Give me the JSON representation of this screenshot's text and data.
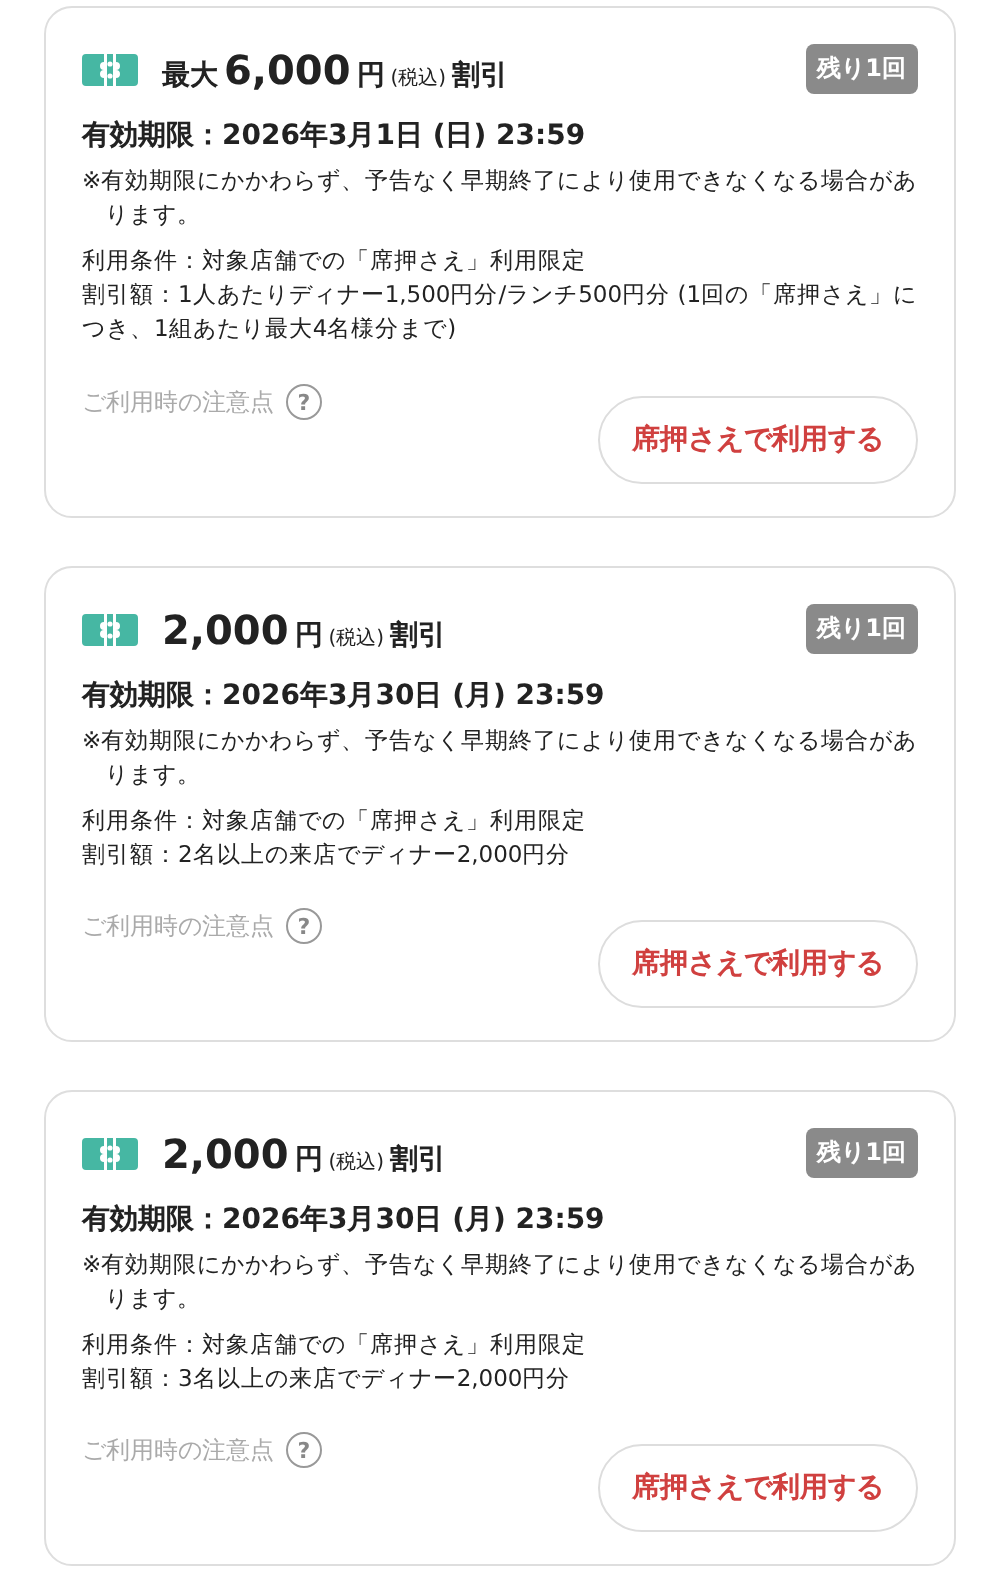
{
  "coupons": [
    {
      "prefix": "最大",
      "amount": "6,000",
      "unit": "円",
      "tax": "(税込)",
      "suffix": "割引",
      "remaining": "残り1回",
      "expiry": "有効期限：2026年3月1日 (日) 23:59",
      "notice": "※有効期限にかかわらず、予告なく早期終了により使用できなくなる場合があります。",
      "conditions": [
        "利用条件：対象店舗での「席押さえ」利用限定",
        "割引額：1人あたりディナー1,500円分/ランチ500円分 (1回の「席押さえ」につき、1組あたり最大4名様分まで)"
      ],
      "help": "ご利用時の注意点",
      "help_icon": "?",
      "button": "席押さえで利用する"
    },
    {
      "amount": "2,000",
      "unit": "円",
      "tax": "(税込)",
      "suffix": "割引",
      "remaining": "残り1回",
      "expiry": "有効期限：2026年3月30日 (月) 23:59",
      "notice": "※有効期限にかかわらず、予告なく早期終了により使用できなくなる場合があります。",
      "conditions": [
        "利用条件：対象店舗での「席押さえ」利用限定",
        "割引額：2名以上の来店でディナー2,000円分"
      ],
      "help": "ご利用時の注意点",
      "help_icon": "?",
      "button": "席押さえで利用する"
    },
    {
      "amount": "2,000",
      "unit": "円",
      "tax": "(税込)",
      "suffix": "割引",
      "remaining": "残り1回",
      "expiry": "有効期限：2026年3月30日 (月) 23:59",
      "notice": "※有効期限にかかわらず、予告なく早期終了により使用できなくなる場合があります。",
      "conditions": [
        "利用条件：対象店舗での「席押さえ」利用限定",
        "割引額：3名以上の来店でディナー2,000円分"
      ],
      "help": "ご利用時の注意点",
      "help_icon": "?",
      "button": "席押さえで利用する"
    }
  ]
}
